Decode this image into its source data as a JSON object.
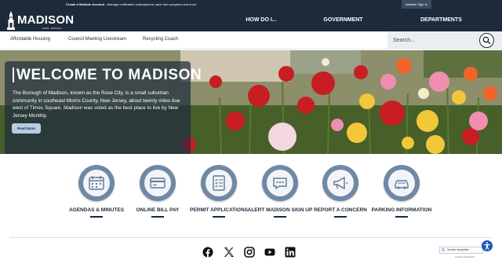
{
  "topbar": {
    "create_label": "Create a Website Account",
    "create_desc": " - Manage notification subscriptions, save form progress and more.",
    "signin": "Website Sign In"
  },
  "header": {
    "logo_text": "MADISON",
    "logo_state": "NEW JERSEY",
    "nav": [
      "HOW DO I...",
      "GOVERNMENT",
      "DEPARTMENTS"
    ]
  },
  "quick_links": [
    "Affordable Housing",
    "Council Meeting Livestream",
    "Recycling Coach"
  ],
  "search": {
    "placeholder": "Search..."
  },
  "hero": {
    "title": "WELCOME TO MADISON",
    "body": "The Borough of Madison, known as the Rose City, is a small suburban community in southeast Morris County, New Jersey, about twenty miles due west of Times Square. Madison was voted as the best place to live by New Jersey Monthly.",
    "button": "Read More"
  },
  "services": [
    {
      "label": "AGENDAS & MINUTES",
      "icon": "calendar-icon"
    },
    {
      "label": "ONLINE BILL PAY",
      "icon": "credit-card-icon"
    },
    {
      "label": "PERMIT APPLICATIONS",
      "icon": "document-checklist-icon"
    },
    {
      "label": "ALERT MADISON SIGN UP",
      "icon": "chat-bubble-icon"
    },
    {
      "label": "REPORT A CONCERN",
      "icon": "megaphone-icon"
    },
    {
      "label": "PARKING INFORMATION",
      "icon": "car-icon"
    }
  ],
  "footer": {
    "social": [
      "facebook-icon",
      "x-icon",
      "instagram-icon",
      "youtube-icon",
      "linkedin-icon"
    ],
    "translate_label": "Sprache auswählen",
    "powered": "Google Übersetzer"
  },
  "colors": {
    "navy": "#1c2a3a",
    "service_ring": "#6f89a5",
    "button": "#b7cde2"
  }
}
